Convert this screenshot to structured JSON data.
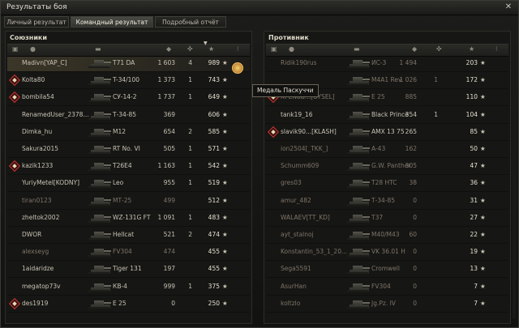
{
  "window": {
    "title": "Результаты боя",
    "close_icon": "close-icon"
  },
  "tabs": [
    {
      "label": "Личный результат",
      "active": false
    },
    {
      "label": "Командный результат",
      "active": true
    },
    {
      "label": "Подробный отчёт",
      "active": false
    }
  ],
  "tooltip": {
    "text": "Медаль Паскуччи"
  },
  "teams": {
    "allies": {
      "title": "Союзники",
      "rows": [
        {
          "player": "Madivn[YAP_C]",
          "vehicle": "T71 DA",
          "damage": "1 603",
          "kills": "4",
          "xp": "989",
          "own": true,
          "medal": false,
          "dead": false
        },
        {
          "player": "Kolta80",
          "vehicle": "T-34/100",
          "damage": "1 373",
          "kills": "1",
          "xp": "743",
          "own": false,
          "medal": true,
          "dead": false
        },
        {
          "player": "bombila54",
          "vehicle": "СУ-14-2",
          "damage": "1 737",
          "kills": "1",
          "xp": "649",
          "own": false,
          "medal": true,
          "dead": false
        },
        {
          "player": "RenamedUser_2378...",
          "vehicle": "Т-34-85",
          "damage": "369",
          "kills": "",
          "xp": "606",
          "own": false,
          "medal": false,
          "dead": false
        },
        {
          "player": "Dimka_hu",
          "vehicle": "M12",
          "damage": "654",
          "kills": "2",
          "xp": "585",
          "own": false,
          "medal": false,
          "dead": false
        },
        {
          "player": "Sakura2015",
          "vehicle": "RT No. VI",
          "damage": "505",
          "kills": "1",
          "xp": "571",
          "own": false,
          "medal": false,
          "dead": false
        },
        {
          "player": "kazik1233",
          "vehicle": "T26E4",
          "damage": "1 163",
          "kills": "1",
          "xp": "542",
          "own": false,
          "medal": true,
          "dead": false
        },
        {
          "player": "YuriyMetel[KODNY]",
          "vehicle": "Leo",
          "damage": "955",
          "kills": "1",
          "xp": "519",
          "own": false,
          "medal": false,
          "dead": false
        },
        {
          "player": "tiran0123",
          "vehicle": "МТ-25",
          "damage": "499",
          "kills": "",
          "xp": "512",
          "own": false,
          "medal": false,
          "dead": true
        },
        {
          "player": "zheltok2002",
          "vehicle": "WZ-131G FT",
          "damage": "1 091",
          "kills": "1",
          "xp": "483",
          "own": false,
          "medal": false,
          "dead": false
        },
        {
          "player": "DWOR",
          "vehicle": "Hellcat",
          "damage": "521",
          "kills": "2",
          "xp": "474",
          "own": false,
          "medal": false,
          "dead": false
        },
        {
          "player": "alexseyg",
          "vehicle": "FV304",
          "damage": "474",
          "kills": "",
          "xp": "455",
          "own": false,
          "medal": false,
          "dead": true
        },
        {
          "player": "1aidaridze",
          "vehicle": "Tiger 131",
          "damage": "197",
          "kills": "",
          "xp": "455",
          "own": false,
          "medal": false,
          "dead": false
        },
        {
          "player": "megatop73v",
          "vehicle": "КВ-4",
          "damage": "999",
          "kills": "1",
          "xp": "375",
          "own": false,
          "medal": false,
          "dead": false
        },
        {
          "player": "des1919",
          "vehicle": "E 25",
          "damage": "0",
          "kills": "",
          "xp": "250",
          "own": false,
          "medal": true,
          "dead": false
        }
      ]
    },
    "enemies": {
      "title": "Противник",
      "rows": [
        {
          "player": "Ridik190rus",
          "vehicle": "ИС-3",
          "damage": "1 494",
          "kills": "",
          "xp": "203",
          "medal": false,
          "dead": true
        },
        {
          "player": "",
          "vehicle": "M4A1 Rev.",
          "damage": "1 026",
          "kills": "1",
          "xp": "172",
          "medal": false,
          "dead": true
        },
        {
          "player": "XPEN0B...[OYSEL]",
          "vehicle": "E 25",
          "damage": "885",
          "kills": "",
          "xp": "110",
          "medal": true,
          "dead": true
        },
        {
          "player": "tank19_16",
          "vehicle": "Black Prince",
          "damage": "354",
          "kills": "1",
          "xp": "104",
          "medal": false,
          "dead": false
        },
        {
          "player": "slavik90...[KLASH]",
          "vehicle": "AMX 13 75",
          "damage": "265",
          "kills": "",
          "xp": "85",
          "medal": true,
          "dead": false
        },
        {
          "player": "ion2504[_TKK_]",
          "vehicle": "A-43",
          "damage": "162",
          "kills": "",
          "xp": "50",
          "medal": false,
          "dead": true
        },
        {
          "player": "Schumm609",
          "vehicle": "G.W. Panther",
          "damage": "305",
          "kills": "",
          "xp": "47",
          "medal": false,
          "dead": true
        },
        {
          "player": "gres03",
          "vehicle": "T28 HTC",
          "damage": "38",
          "kills": "",
          "xp": "36",
          "medal": false,
          "dead": true
        },
        {
          "player": "amur_482",
          "vehicle": "Т-34-85",
          "damage": "0",
          "kills": "",
          "xp": "31",
          "medal": false,
          "dead": true
        },
        {
          "player": "WALAEV[TT_KD]",
          "vehicle": "T37",
          "damage": "0",
          "kills": "",
          "xp": "27",
          "medal": false,
          "dead": true
        },
        {
          "player": "ayt_stalnoj",
          "vehicle": "M40/M43",
          "damage": "60",
          "kills": "",
          "xp": "22",
          "medal": false,
          "dead": true
        },
        {
          "player": "Konstantin_53_1_20...",
          "vehicle": "VK 36.01 H",
          "damage": "0",
          "kills": "",
          "xp": "19",
          "medal": false,
          "dead": true
        },
        {
          "player": "Sega5591",
          "vehicle": "Cromwell",
          "damage": "0",
          "kills": "",
          "xp": "13",
          "medal": false,
          "dead": true
        },
        {
          "player": "AsurHan",
          "vehicle": "FV304",
          "damage": "0",
          "kills": "",
          "xp": "7",
          "medal": false,
          "dead": true
        },
        {
          "player": "koltzlo",
          "vehicle": "Jg.Pz. IV",
          "damage": "0",
          "kills": "",
          "xp": "7",
          "medal": false,
          "dead": true
        }
      ]
    }
  }
}
